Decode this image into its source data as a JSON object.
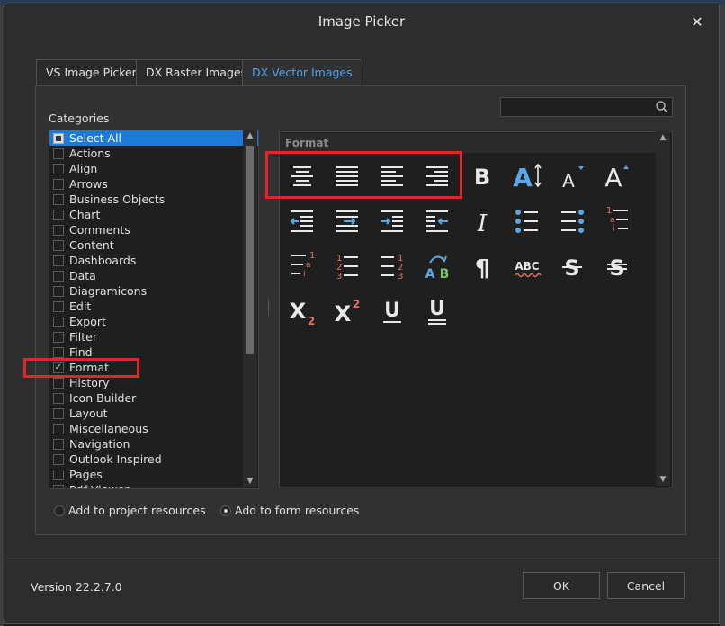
{
  "window": {
    "title": "Image Picker",
    "close_glyph": "✕"
  },
  "tabs": [
    {
      "label": "VS Image Picker",
      "active": false
    },
    {
      "label": "DX Raster Images",
      "active": false
    },
    {
      "label": "DX Vector Images",
      "active": true
    }
  ],
  "categories": {
    "heading": "Categories",
    "items": [
      {
        "label": "Select All",
        "checked": "partial",
        "selected": true
      },
      {
        "label": "Actions",
        "checked": false
      },
      {
        "label": "Align",
        "checked": false
      },
      {
        "label": "Arrows",
        "checked": false
      },
      {
        "label": "Business Objects",
        "checked": false
      },
      {
        "label": "Chart",
        "checked": false
      },
      {
        "label": "Comments",
        "checked": false
      },
      {
        "label": "Content",
        "checked": false
      },
      {
        "label": "Dashboards",
        "checked": false
      },
      {
        "label": "Data",
        "checked": false
      },
      {
        "label": "Diagramicons",
        "checked": false
      },
      {
        "label": "Edit",
        "checked": false
      },
      {
        "label": "Export",
        "checked": false
      },
      {
        "label": "Filter",
        "checked": false
      },
      {
        "label": "Find",
        "checked": false
      },
      {
        "label": "Format",
        "checked": true
      },
      {
        "label": "History",
        "checked": false
      },
      {
        "label": "Icon Builder",
        "checked": false
      },
      {
        "label": "Layout",
        "checked": false
      },
      {
        "label": "Miscellaneous",
        "checked": false
      },
      {
        "label": "Navigation",
        "checked": false
      },
      {
        "label": "Outlook Inspired",
        "checked": false
      },
      {
        "label": "Pages",
        "checked": false
      },
      {
        "label": "Pdf Viewer",
        "checked": false
      }
    ]
  },
  "search": {
    "placeholder": "",
    "value": ""
  },
  "image_group": {
    "header": "Format",
    "icons": [
      "align-center-icon",
      "align-justify-icon",
      "align-left-icon",
      "align-right-icon",
      "bold-icon",
      "font-size-icon",
      "font-size-decrease-icon",
      "font-size-increase-icon",
      "indent-decrease-icon",
      "indent-increase-icon",
      "first-line-indent-icon",
      "hanging-indent-icon",
      "italic-icon",
      "bullets-icon",
      "bullets-right-icon",
      "multilevel-list-icon",
      "multilevel-list-right-icon",
      "numbering-icon",
      "numbering-right-icon",
      "change-case-icon",
      "paragraph-mark-icon",
      "spell-check-icon",
      "strikethrough-icon",
      "double-strikethrough-icon",
      "subscript-icon",
      "superscript-icon",
      "underline-icon",
      "double-underline-icon"
    ]
  },
  "options": {
    "add_project": "Add to project resources",
    "add_form": "Add to form resources",
    "selected": "form"
  },
  "footer": {
    "version": "Version 22.2.7.0",
    "ok": "OK",
    "cancel": "Cancel"
  },
  "colors": {
    "accent": "#4aa3f0",
    "highlight_box": "#e0262b",
    "selection": "#1f7ad6",
    "icon_blue": "#5aa8e8",
    "icon_red": "#e0755f"
  }
}
